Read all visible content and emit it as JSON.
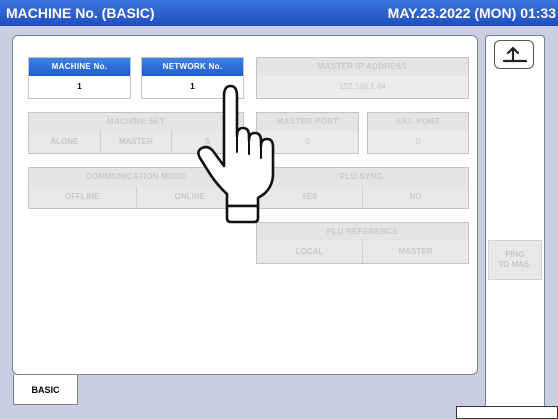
{
  "header": {
    "title": "MACHINE No. (BASIC)",
    "datetime": "MAY.23.2022 (MON) 01:33"
  },
  "machine_no": {
    "label": "MACHINE No.",
    "value": "1"
  },
  "network_no": {
    "label": "NETWORK No.",
    "value": "1"
  },
  "master_ip": {
    "label": "MASTER IP ADDRESS",
    "value": "192.168.1.84"
  },
  "machine_set": {
    "label": "MACHINE SET",
    "options": [
      "ALONE",
      "MASTER",
      "S"
    ]
  },
  "master_port": {
    "label": "MASTER PORT",
    "value": "0"
  },
  "sat_port": {
    "label": "SAT. PORT",
    "value": "0"
  },
  "communication_mode": {
    "label": "COMMUNICATION MODE",
    "options": [
      "OFFLINE",
      "ONLINE"
    ]
  },
  "plu_sync": {
    "label": "PLU SYNC.",
    "options": [
      "YES",
      "NO"
    ]
  },
  "plu_reference": {
    "label": "PLU REFERENCE",
    "options": [
      "LOCAL",
      "MASTER"
    ]
  },
  "ping_button": {
    "line1": "PING",
    "line2": "TO MAS."
  },
  "tabs": [
    {
      "label": "BASIC"
    }
  ],
  "icons": {
    "back": "return-arrow-icon",
    "pointer": "pointing-hand-icon"
  }
}
